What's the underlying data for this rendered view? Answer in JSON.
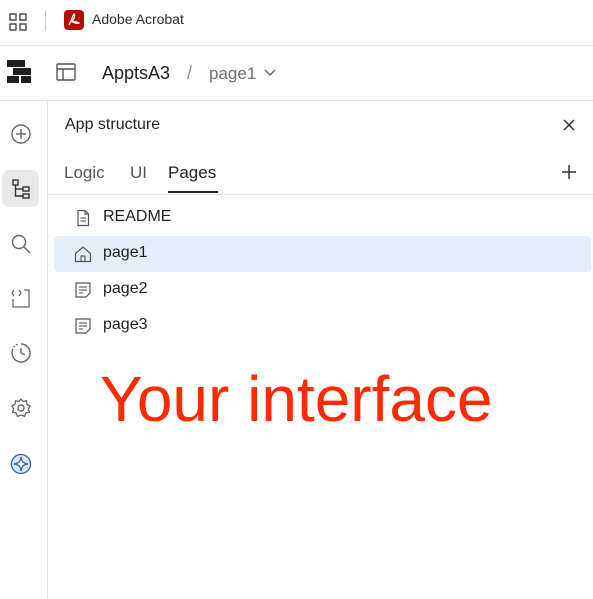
{
  "browser_bar": {
    "app_name": "Adobe Acrobat"
  },
  "header": {
    "app_title": "ApptsA3",
    "separator": "/",
    "current_page": "page1"
  },
  "panel": {
    "title": "App structure",
    "tabs": [
      {
        "label": "Logic"
      },
      {
        "label": "UI"
      },
      {
        "label": "Pages",
        "active": true
      }
    ],
    "pages": [
      {
        "label": "README",
        "icon": "document-icon"
      },
      {
        "label": "page1",
        "icon": "home-icon",
        "selected": true
      },
      {
        "label": "page2",
        "icon": "page-icon"
      },
      {
        "label": "page3",
        "icon": "page-icon"
      }
    ]
  },
  "overlay": {
    "text": "Your interface"
  },
  "colors": {
    "accent_red": "#ff2a00",
    "selected_bg": "#e4eefb",
    "acrobat_red": "#b30b00"
  }
}
